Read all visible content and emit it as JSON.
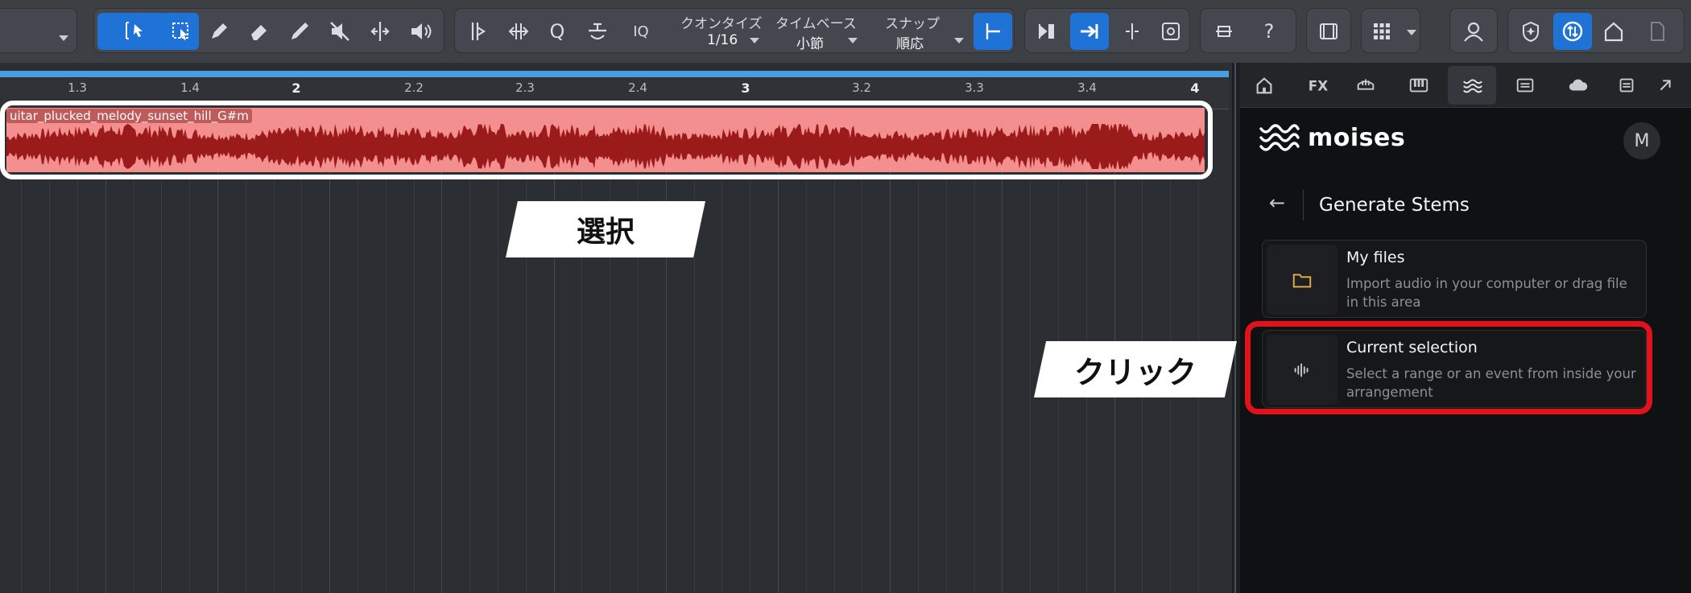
{
  "toolbar": {
    "quantize_label": "クオンタイズ",
    "quantize_value": "1/16",
    "timebase_label": "タイムベース",
    "timebase_value": "小節",
    "snap_label": "スナップ",
    "snap_value": "順応",
    "iq_label": "IQ",
    "q_label": "Q",
    "help_label": "?",
    "accent_color": "#1f72d6"
  },
  "ruler": {
    "labels": [
      "1.3",
      "1.4",
      "2",
      "2.2",
      "2.3",
      "2.4",
      "3",
      "3.2",
      "3.3",
      "3.4",
      "4"
    ]
  },
  "clip": {
    "name": "uitar_plucked_melody_sunset_hill_G#m",
    "color": "#f48f8f",
    "wave_color": "#9b1b1b"
  },
  "callouts": {
    "select_label": "選択",
    "click_label": "クリック"
  },
  "panel": {
    "brand": "moises",
    "avatar_initial": "M",
    "back_label": "←",
    "title": "Generate Stems",
    "cards": [
      {
        "title": "My files",
        "description": "Import audio in your computer or drag file in this area",
        "icon": "folder-icon"
      },
      {
        "title": "Current selection",
        "description": "Select a range or an event from inside your arrangement",
        "icon": "waveform-icon"
      }
    ],
    "highlight_color": "#e1121a"
  }
}
